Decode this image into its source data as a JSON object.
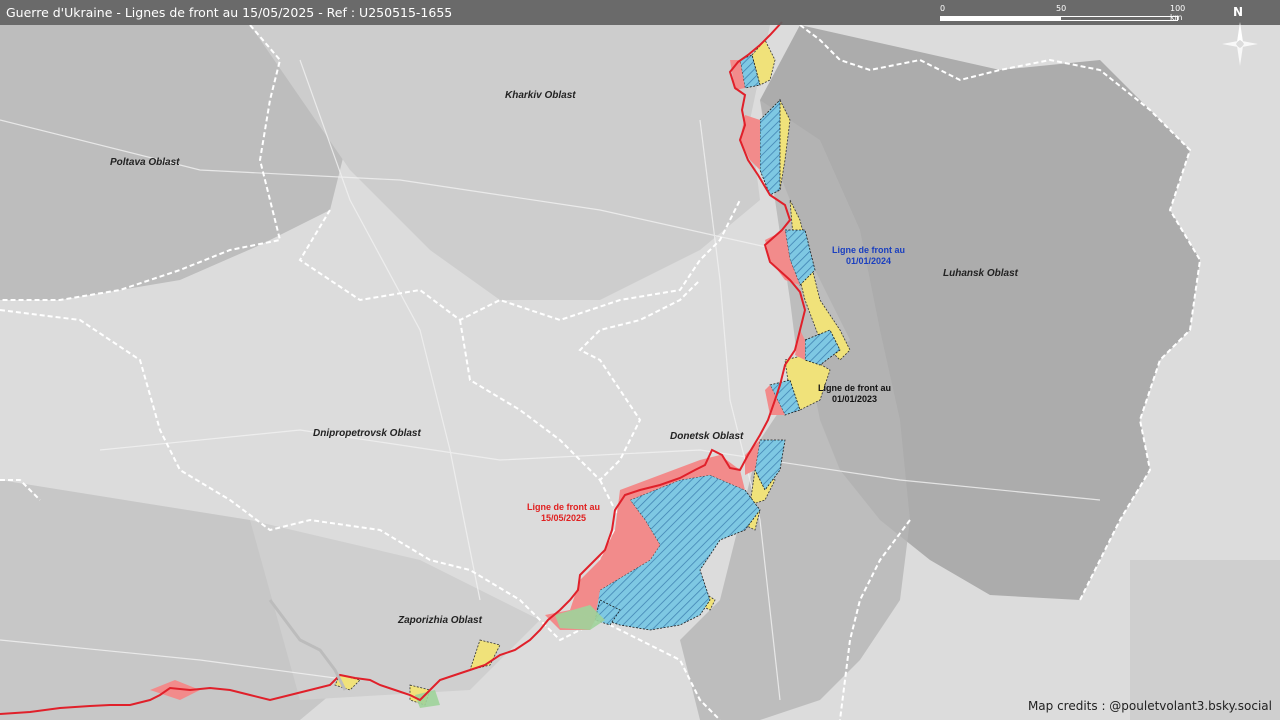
{
  "title": "Guerre d'Ukraine - Lignes de front au 15/05/2025 - Ref : U250515-1655",
  "scale": {
    "labels": [
      "0",
      "50",
      "100 km"
    ]
  },
  "north": "N",
  "oblasts": [
    {
      "name": "Kharkiv Oblast"
    },
    {
      "name": "Poltava Oblast"
    },
    {
      "name": "Luhansk Oblast"
    },
    {
      "name": "Dnipropetrovsk Oblast"
    },
    {
      "name": "Donetsk Oblast"
    },
    {
      "name": "Zaporizhia Oblast"
    }
  ],
  "front_labels": [
    {
      "text": "Ligne de front au\n01/01/2024",
      "color": "#1a3fbf"
    },
    {
      "text": "Ligne de front au\n01/01/2023",
      "color": "#111111"
    },
    {
      "text": "Ligne de front au\n15/05/2025",
      "color": "#e02020"
    }
  ],
  "colors": {
    "front_2025": "#e0202a",
    "occupied_2025": "#f28b8b",
    "occupied_2024": "#7ec8e3",
    "occupied_2023": "#f0e27a",
    "luhansk_region": "#a6a6a6",
    "oblast_border": "#ffffff"
  },
  "credits": "Map credits : @pouletvolant3.bsky.social"
}
